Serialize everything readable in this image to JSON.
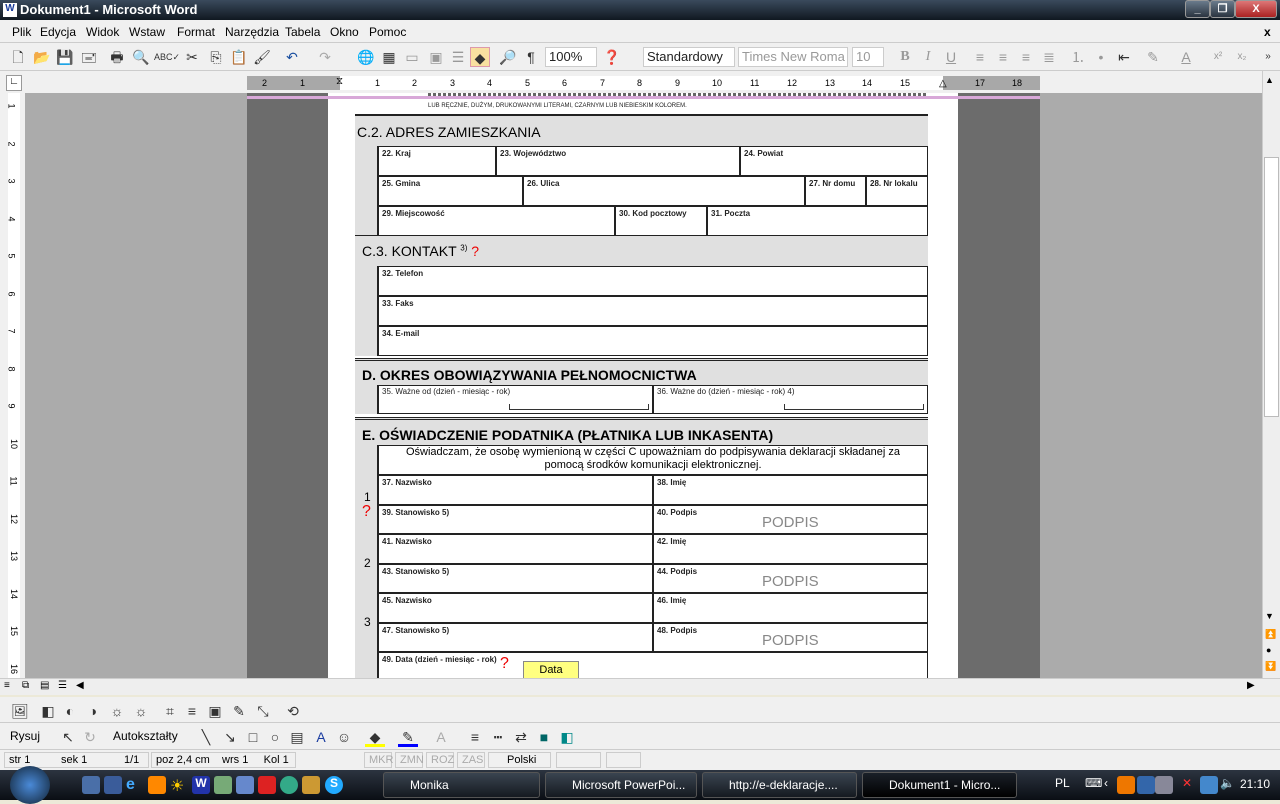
{
  "window": {
    "title": "Dokument1 - Microsoft Word",
    "minimize": "_",
    "restore": "❐",
    "close": "X"
  },
  "menu": [
    "Plik",
    "Edycja",
    "Widok",
    "Wstaw",
    "Format",
    "Narzędzia",
    "Tabela",
    "Okno",
    "Pomoc"
  ],
  "menu_close": "x",
  "toolbar": {
    "zoom": "100%",
    "style": "Standardowy",
    "font": "Times New Roma",
    "size": "10",
    "bold": "B",
    "italic": "I",
    "underline": "U"
  },
  "ruler": {
    "left": [
      "2",
      "1"
    ],
    "right": [
      "1",
      "2",
      "3",
      "4",
      "5",
      "6",
      "7",
      "8",
      "9",
      "10",
      "11",
      "12",
      "13",
      "14",
      "15",
      "17",
      "18"
    ],
    "vertical": [
      "1",
      "2",
      "3",
      "4",
      "5",
      "6",
      "7",
      "8",
      "9",
      "10",
      "11",
      "12",
      "13",
      "14",
      "15",
      "16"
    ]
  },
  "form": {
    "intro": "LUB RĘCZNIE, DUŻYM, DRUKOWANYMI LITERAMI, CZARNYM LUB NIEBIESKIM KOLOREM.",
    "c2": {
      "title": "C.2. ADRES ZAMIESZKANIA",
      "fields": [
        "22. Kraj",
        "23. Województwo",
        "24. Powiat",
        "25. Gmina",
        "26. Ulica",
        "27. Nr domu",
        "28. Nr lokalu",
        "29. Miejscowość",
        "30. Kod pocztowy",
        "31. Poczta"
      ]
    },
    "c3": {
      "title": "C.3. KONTAKT",
      "sup": "3)",
      "help": "?",
      "fields": [
        "32. Telefon",
        "33. Faks",
        "34. E-mail"
      ]
    },
    "d": {
      "title": "D. OKRES OBOWIĄZYWANIA PEŁNOMOCNICTWA",
      "fields": [
        "35. Ważne od (dzień - miesiąc - rok)",
        "36. Ważne do (dzień - miesiąc - rok) 4)"
      ]
    },
    "e": {
      "title": "E. OŚWIADCZENIE PODATNIKA (PŁATNIKA LUB INKASENTA)",
      "statement": "Oświadczam, że osobę wymienioną w części C upoważniam do podpisywania deklaracji składanej za pomocą środków komunikacji elektronicznej.",
      "persons": [
        {
          "n": "1",
          "nazwisko": "37. Nazwisko",
          "imie": "38. Imię",
          "stanowisko": "39. Stanowisko 5)",
          "podpis": "40. Podpis",
          "sig": "PODPIS",
          "help": "?"
        },
        {
          "n": "2",
          "nazwisko": "41. Nazwisko",
          "imie": "42. Imię",
          "stanowisko": "43. Stanowisko 5)",
          "podpis": "44. Podpis",
          "sig": "PODPIS"
        },
        {
          "n": "3",
          "nazwisko": "45. Nazwisko",
          "imie": "46. Imię",
          "stanowisko": "47. Stanowisko 5)",
          "podpis": "48. Podpis",
          "sig": "PODPIS"
        }
      ],
      "date_label": "49. Data (dzień - miesiąc - rok)",
      "date_help": "?",
      "date_button": "Data"
    }
  },
  "drawing": {
    "draw": "Rysuj",
    "autoshapes": "Autokształty"
  },
  "status": {
    "page": "str 1",
    "section": "sek 1",
    "pages": "1/1",
    "pos": "poz 2,4 cm",
    "line": "wrs 1",
    "col": "Kol 1",
    "mkr": "MKR",
    "zmn": "ZMN",
    "roz": "ROZ",
    "zas": "ZAS",
    "lang": "Polski"
  },
  "taskbar": {
    "tasks": [
      "Monika",
      "Microsoft PowerPoi...",
      "http://e-deklaracje....",
      "Dokument1 - Micro..."
    ],
    "lang": "PL",
    "clock": "21:10"
  }
}
